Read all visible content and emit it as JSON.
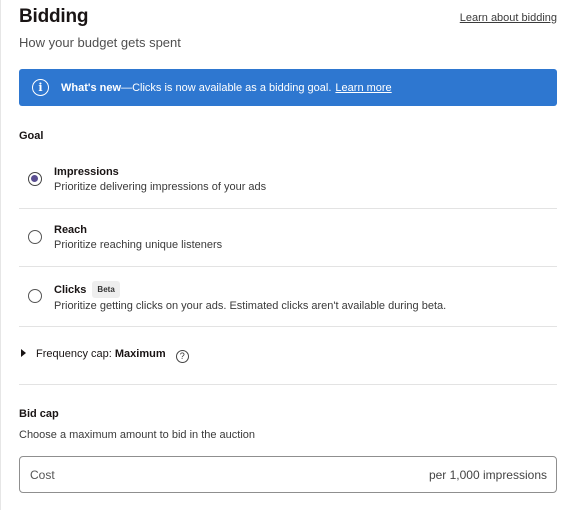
{
  "header": {
    "title": "Bidding",
    "subtitle": "How your budget gets spent",
    "learn_link": "Learn about bidding"
  },
  "banner": {
    "icon": "info-icon",
    "strong": "What's new",
    "text": "—Clicks is now available as a bidding goal.",
    "link": "Learn more",
    "color": "#2e77d0"
  },
  "goal": {
    "label": "Goal",
    "selected": "Impressions",
    "options": [
      {
        "title": "Impressions",
        "description": "Prioritize delivering impressions of your ads",
        "checked": true
      },
      {
        "title": "Reach",
        "description": "Prioritize reaching unique listeners",
        "checked": false
      },
      {
        "title": "Clicks",
        "badge": "Beta",
        "description": "Prioritize getting clicks on your ads. Estimated clicks aren't available during beta.",
        "checked": false
      }
    ]
  },
  "frequency_cap": {
    "label": "Frequency cap:",
    "value": "Maximum",
    "help_icon": "question-circle-icon"
  },
  "bid_cap": {
    "label": "Bid cap",
    "description": "Choose a maximum amount to bid in the auction",
    "placeholder": "Cost",
    "suffix": "per 1,000 impressions"
  }
}
